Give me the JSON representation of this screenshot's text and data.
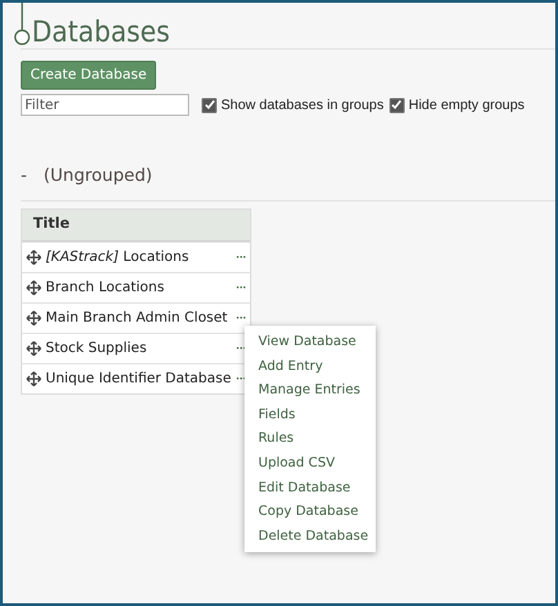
{
  "page_title": "Databases",
  "create_button": "Create Database",
  "filter": {
    "placeholder": "Filter"
  },
  "options": [
    {
      "label": "Show databases in groups",
      "checked": true
    },
    {
      "label": "Hide empty groups",
      "checked": true
    }
  ],
  "group": {
    "toggle": "-",
    "name": "(Ungrouped)"
  },
  "table": {
    "columns": [
      "Title"
    ],
    "rows": [
      {
        "title": "*[KAStrack]* Locations",
        "menu": "•••"
      },
      {
        "title": "Branch Locations",
        "menu": "•••"
      },
      {
        "title": "Main Branch Admin Closet",
        "menu": "•••"
      },
      {
        "title": "Stock Supplies",
        "menu": "•••"
      },
      {
        "title": "Unique Identifier Database",
        "menu": "•••"
      }
    ]
  },
  "context_menu": [
    "View Database",
    "Add Entry",
    "Manage Entries",
    "Fields",
    "Rules",
    "Upload CSV",
    "Edit Database",
    "Copy Database",
    "Delete Database"
  ]
}
